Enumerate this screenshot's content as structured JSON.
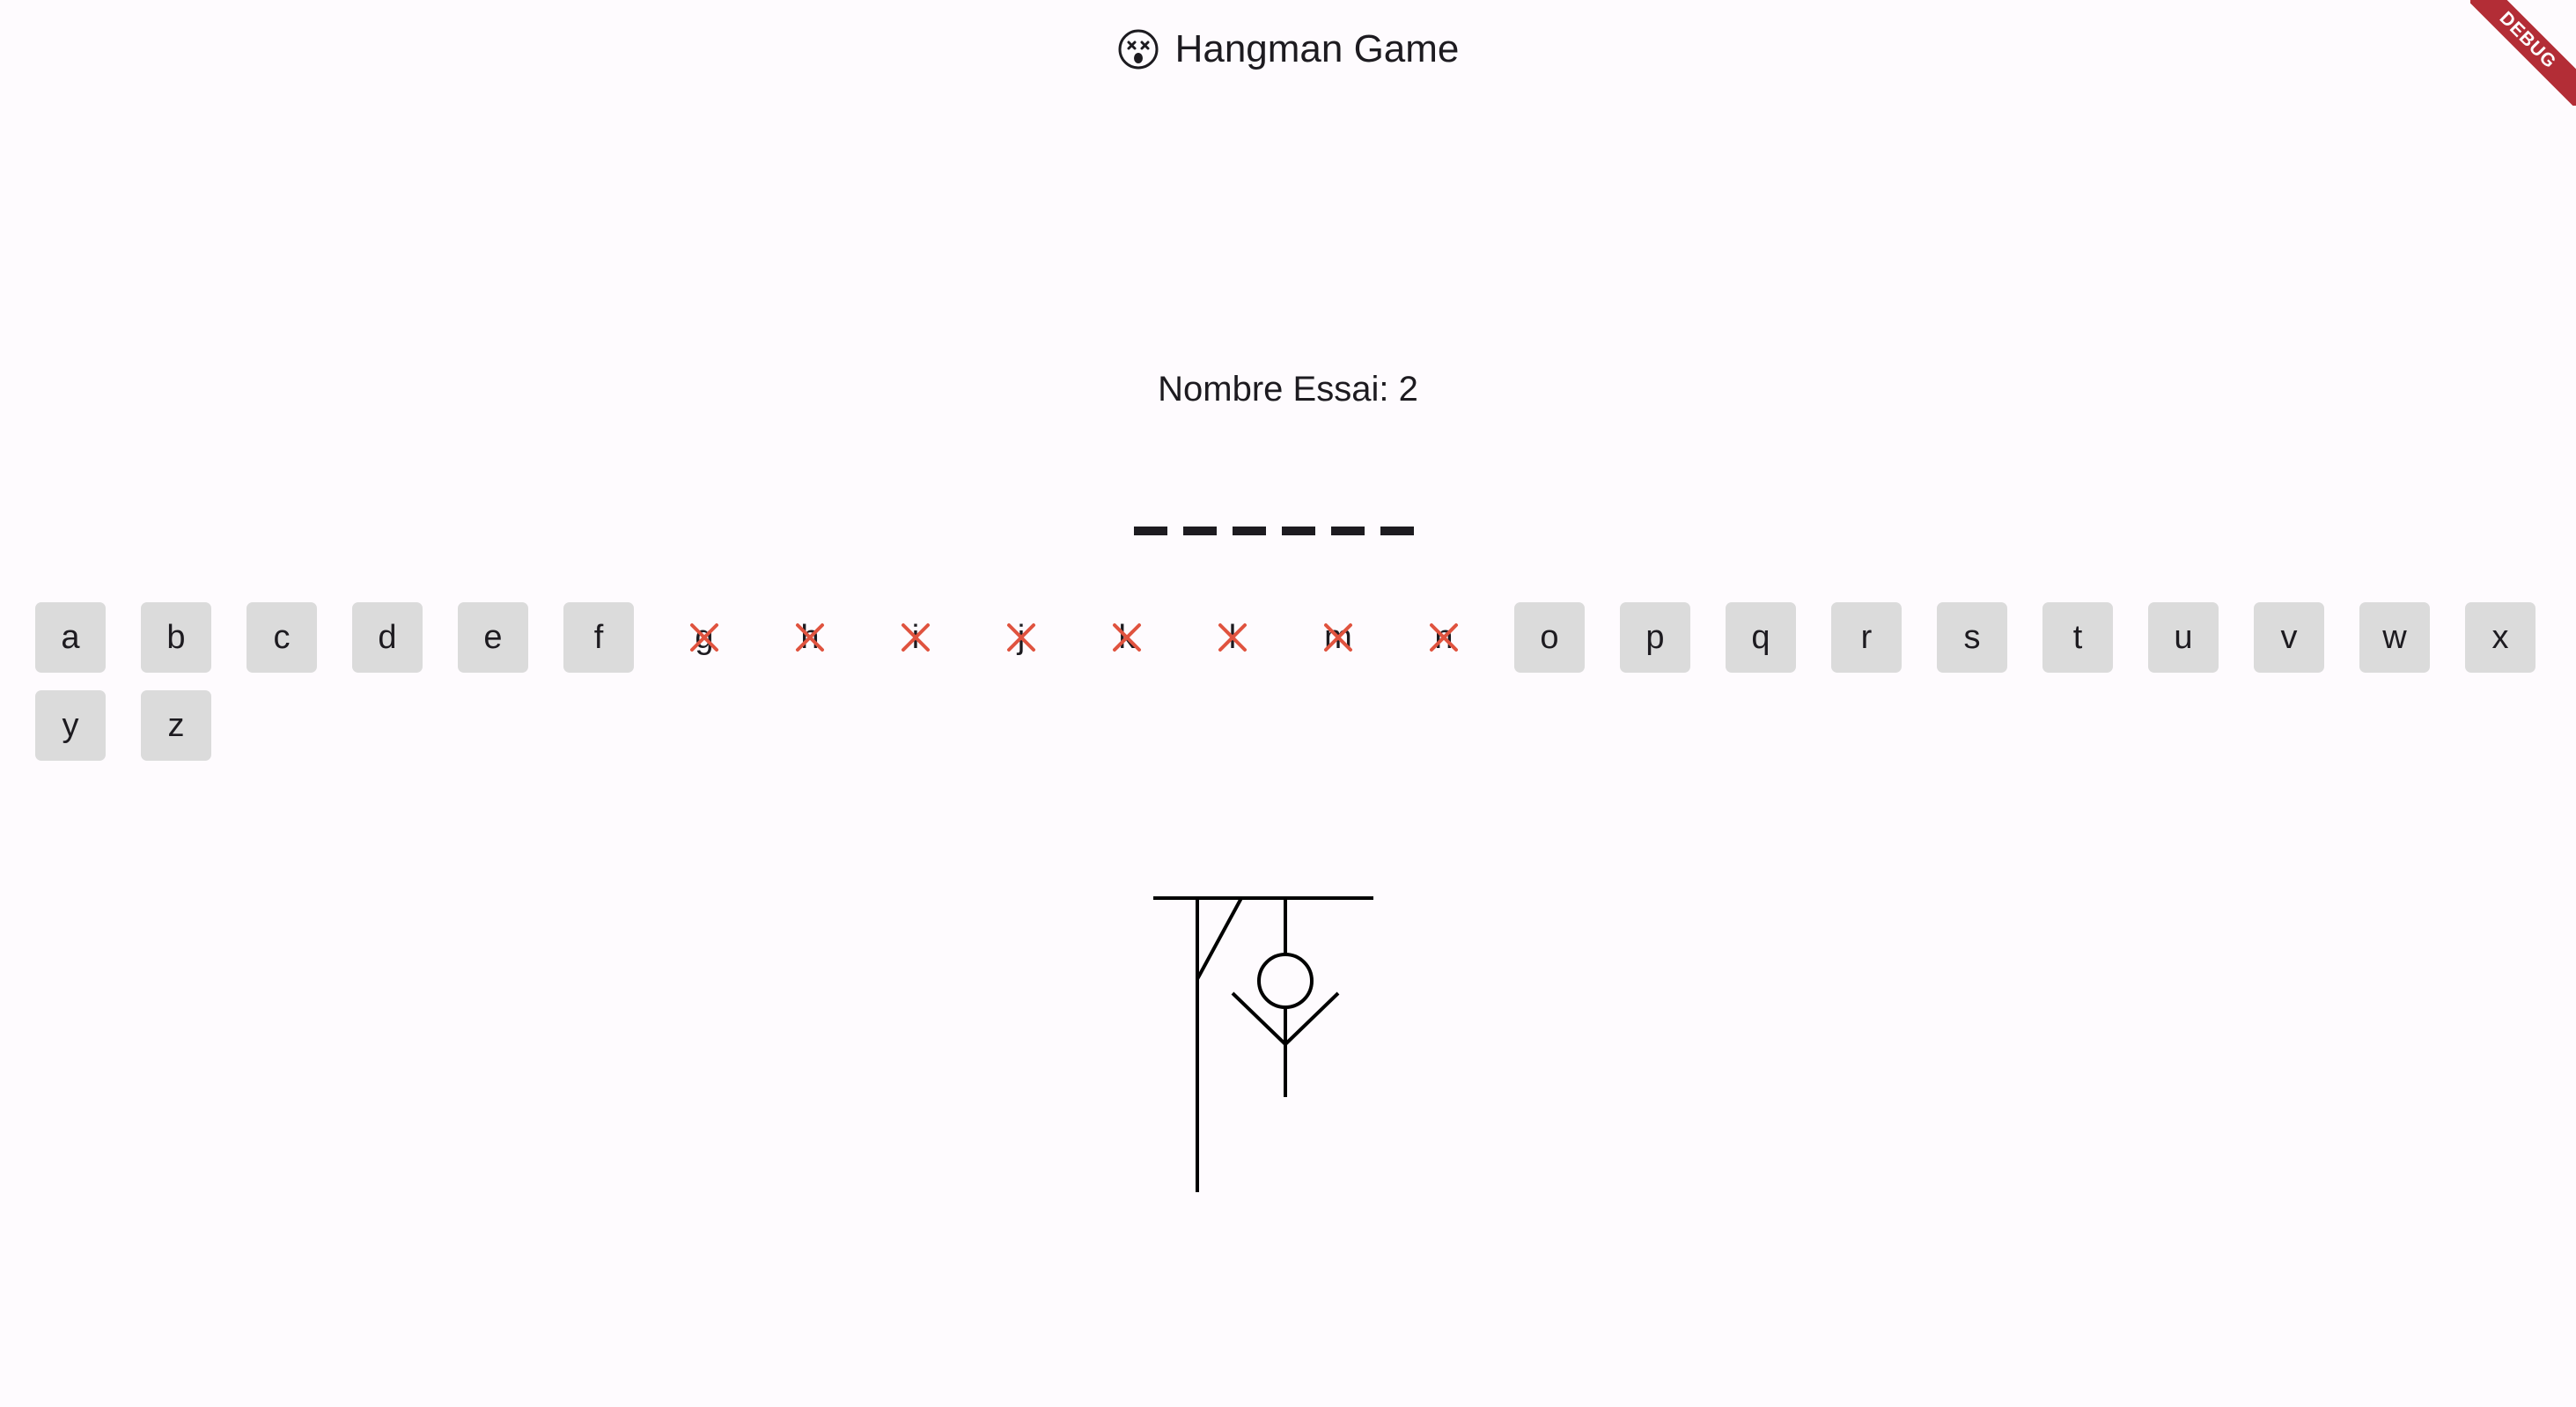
{
  "appbar": {
    "title": "Hangman Game",
    "icon": "dizzy-face-icon"
  },
  "debug_banner": "DEBUG",
  "attempts_label": "Nombre Essai: 2",
  "word": {
    "length": 6
  },
  "keyboard": {
    "keys": [
      {
        "letter": "a",
        "used": false
      },
      {
        "letter": "b",
        "used": false
      },
      {
        "letter": "c",
        "used": false
      },
      {
        "letter": "d",
        "used": false
      },
      {
        "letter": "e",
        "used": false
      },
      {
        "letter": "f",
        "used": false
      },
      {
        "letter": "g",
        "used": true
      },
      {
        "letter": "h",
        "used": true
      },
      {
        "letter": "i",
        "used": true
      },
      {
        "letter": "j",
        "used": true
      },
      {
        "letter": "k",
        "used": true
      },
      {
        "letter": "l",
        "used": true
      },
      {
        "letter": "m",
        "used": true
      },
      {
        "letter": "n",
        "used": true
      },
      {
        "letter": "o",
        "used": false
      },
      {
        "letter": "p",
        "used": false
      },
      {
        "letter": "q",
        "used": false
      },
      {
        "letter": "r",
        "used": false
      },
      {
        "letter": "s",
        "used": false
      },
      {
        "letter": "t",
        "used": false
      },
      {
        "letter": "u",
        "used": false
      },
      {
        "letter": "v",
        "used": false
      },
      {
        "letter": "w",
        "used": false
      },
      {
        "letter": "x",
        "used": false
      },
      {
        "letter": "y",
        "used": false
      },
      {
        "letter": "z",
        "used": false
      }
    ]
  },
  "colors": {
    "background": "#fefbfe",
    "key_bg": "#dbdbdb",
    "cross": "#e0533f",
    "debug": "#b32d36",
    "text": "#1d1b20"
  }
}
